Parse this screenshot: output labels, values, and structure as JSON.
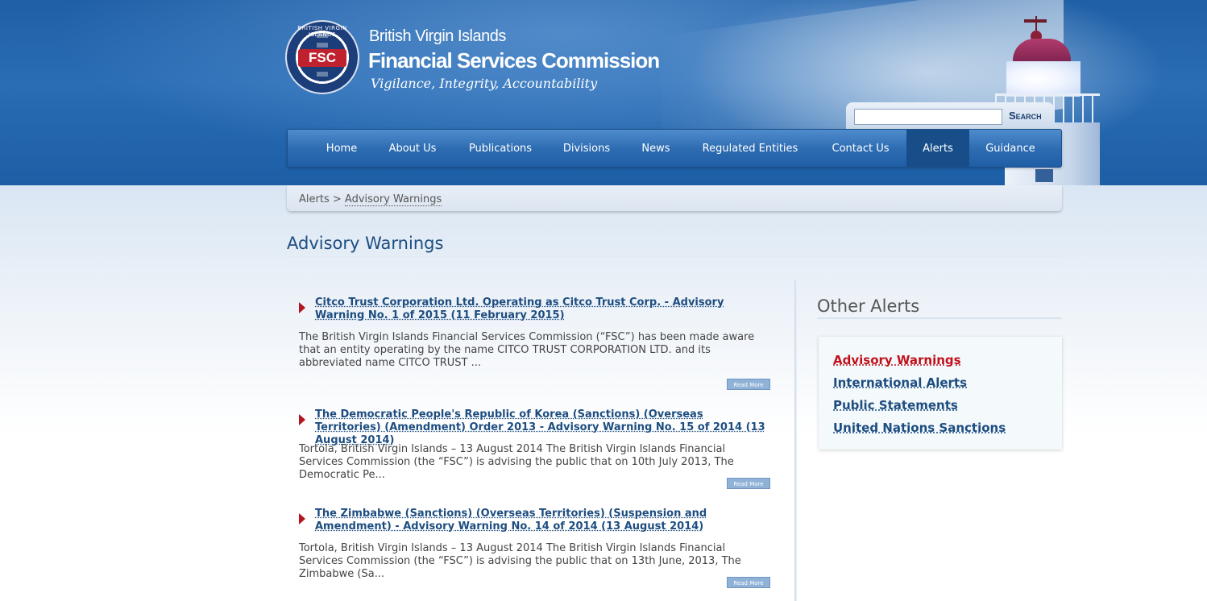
{
  "header": {
    "seal_text": "BRITISH VIRGIN ISLANDS",
    "seal_initials": "FSC",
    "title_line1": "British Virgin Islands",
    "title_line2": "Financial Services Commission",
    "tagline": "Vigilance, Integrity, Accountability"
  },
  "search": {
    "value": "",
    "button_label": "Search"
  },
  "nav": {
    "items": [
      {
        "label": "Home"
      },
      {
        "label": "About Us"
      },
      {
        "label": "Publications"
      },
      {
        "label": "Divisions"
      },
      {
        "label": "News"
      },
      {
        "label": "Regulated Entities"
      },
      {
        "label": "Contact Us"
      },
      {
        "label": "Alerts",
        "active": true
      },
      {
        "label": "Guidance"
      }
    ]
  },
  "breadcrumb": {
    "parent": "Alerts",
    "separator": ">",
    "current": "Advisory Warnings"
  },
  "page": {
    "title": "Advisory Warnings"
  },
  "articles": [
    {
      "title": "Citco Trust Corporation Ltd. Operating as Citco Trust Corp. - Advisory Warning No. 1 of 2015 (11 February 2015)",
      "excerpt": "The British Virgin Islands Financial Services Commission (“FSC”) has been made aware that an entity operating by the name CITCO TRUST CORPORATION LTD. and its abbreviated name CITCO TRUST ...",
      "read_more": "Read More"
    },
    {
      "title": "The Democratic People's Republic of Korea (Sanctions) (Overseas Territories) (Amendment) Order 2013 - Advisory Warning No. 15 of 2014 (13 August 2014)",
      "excerpt": "Tortola, British Virgin Islands – 13 August 2014 The British Virgin Islands Financial Services Commission (the “FSC”) is advising the public that on 10th July 2013, The Democratic Pe...",
      "read_more": "Read More"
    },
    {
      "title": "The Zimbabwe (Sanctions) (Overseas Territories) (Suspension and Amendment) - Advisory Warning No. 14 of 2014 (13 August 2014)",
      "excerpt": "Tortola, British Virgin Islands – 13 August 2014 The British Virgin Islands Financial Services Commission (the “FSC”) is advising the public that on 13th June, 2013, The Zimbabwe (Sa...",
      "read_more": "Read More"
    }
  ],
  "sidebar": {
    "title": "Other Alerts",
    "links": [
      {
        "label": "Advisory Warnings",
        "active": true
      },
      {
        "label": "International Alerts"
      },
      {
        "label": "Public Statements"
      },
      {
        "label": "United Nations Sanctions"
      }
    ]
  },
  "colors": {
    "nav_blue": "#2f6db3",
    "link_blue": "#1d4d80",
    "active_red": "#c0111a",
    "arrow_red": "#b3141d"
  }
}
